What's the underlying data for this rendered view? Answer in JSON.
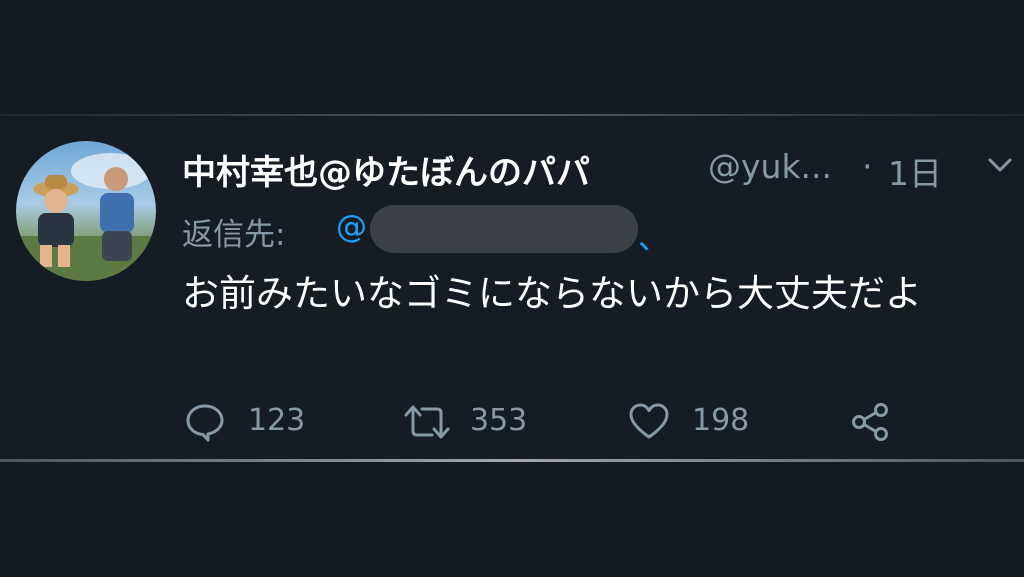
{
  "tweet": {
    "display_name": "中村幸也@ゆたぼんのパパ",
    "handle": "@yuk...",
    "separator": "·",
    "time": "1日",
    "replying_label": "返信先:",
    "mention_at": "@",
    "mention_tail": "、",
    "text": "お前みたいなゴミにならないから大丈夫だよ",
    "reply_count": "123",
    "retweet_count": "353",
    "like_count": "198"
  },
  "icons": {
    "avatar": "profile-photo",
    "menu": "chevron-down-icon",
    "reply": "speech-bubble-icon",
    "retweet": "retweet-icon",
    "like": "heart-icon",
    "share": "share-icon"
  },
  "colors": {
    "background": "#141a22",
    "text": "#ffffff",
    "secondary": "#8899a6",
    "link": "#1da1f2",
    "redaction": "#3c4147"
  }
}
